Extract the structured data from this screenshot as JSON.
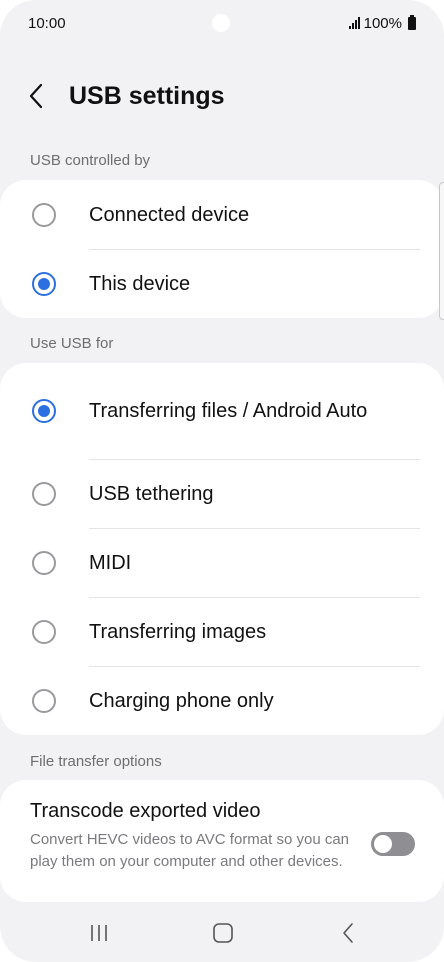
{
  "status_bar": {
    "time": "10:00",
    "battery": "100%",
    "icons": [
      "signal-icon",
      "battery-icon"
    ]
  },
  "header": {
    "title": "USB settings",
    "back_icon": "chevron-left-icon"
  },
  "usb_controlled_by": {
    "label": "USB controlled by",
    "options": [
      {
        "label": "Connected device",
        "selected": false
      },
      {
        "label": "This device",
        "selected": true
      }
    ]
  },
  "use_usb_for": {
    "label": "Use USB for",
    "options": [
      {
        "label": "Transferring files / Android Auto",
        "selected": true
      },
      {
        "label": "USB tethering",
        "selected": false
      },
      {
        "label": "MIDI",
        "selected": false
      },
      {
        "label": "Transferring images",
        "selected": false
      },
      {
        "label": "Charging phone only",
        "selected": false
      }
    ]
  },
  "file_transfer_options": {
    "label": "File transfer options",
    "transcode": {
      "title": "Transcode exported video",
      "description": "Convert HEVC videos to AVC format so you can play them on your computer and other devices.",
      "enabled": false
    }
  },
  "nav_bar": {
    "icons": [
      "recents-icon",
      "home-icon",
      "back-icon"
    ]
  },
  "colors": {
    "accent": "#2c6fe0",
    "background": "#f2f2f4",
    "card": "#ffffff",
    "section_label": "#6d6d72",
    "switch_off": "#8e8e93"
  }
}
